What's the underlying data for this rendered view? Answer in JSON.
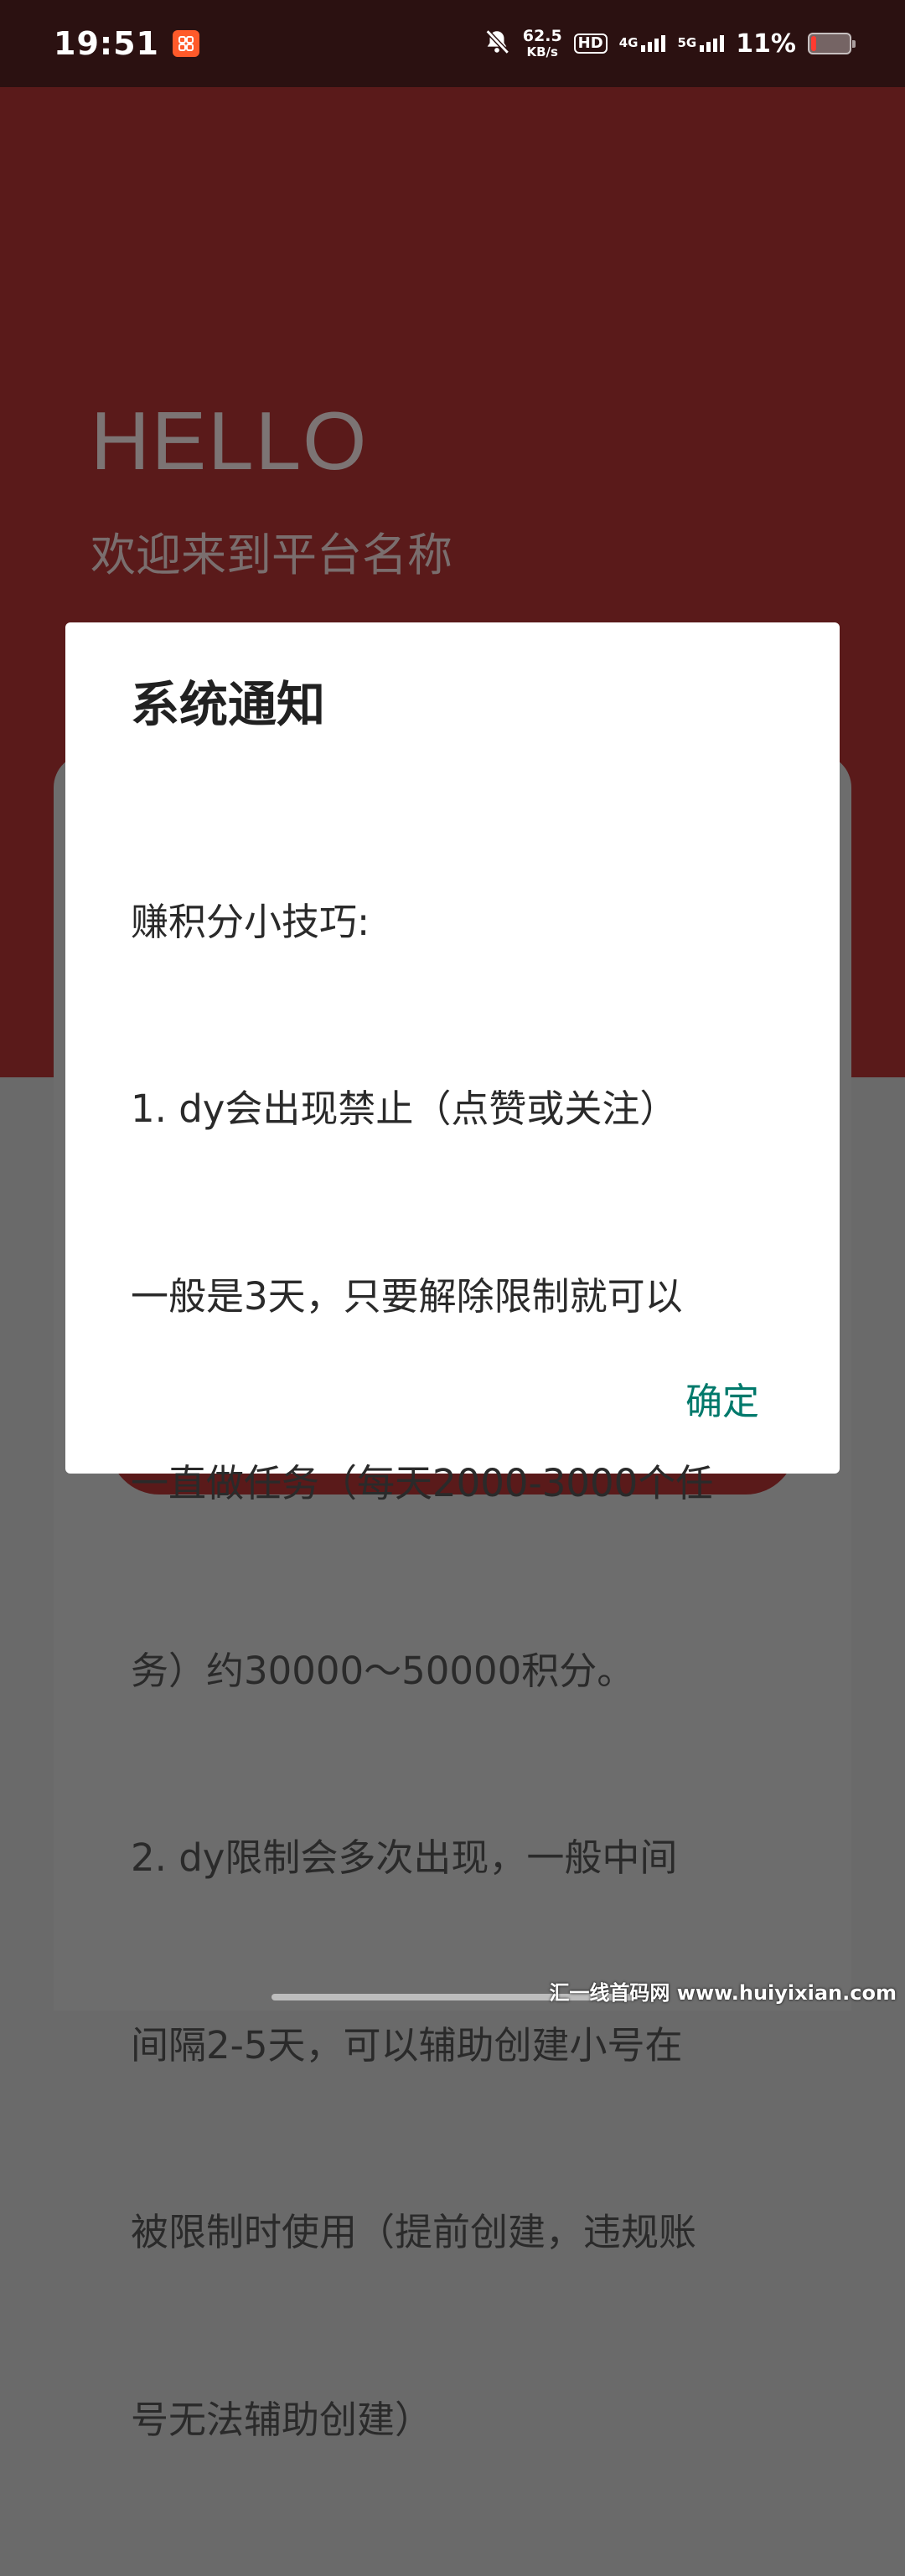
{
  "status_bar": {
    "time": "19:51",
    "app_icon": "app-notification-icon",
    "bell_icon": "bell-muted-icon",
    "speed_value": "62.5",
    "speed_unit": "KB/s",
    "hd_label": "HD",
    "sim1_label": "4G",
    "sim2_label": "5G",
    "battery_percent": "11%",
    "battery_level": 0.11
  },
  "background": {
    "hello": "HELLO",
    "welcome": "欢迎来到平台名称"
  },
  "dialog": {
    "title": "系统通知",
    "body_lines": [
      "赚积分小技巧:",
      "1. dy会出现禁止（点赞或关注）",
      "一般是3天，只要解除限制就可以",
      "一直做任务（每天2000-3000个任",
      "务）约30000～50000积分。",
      "2. dy限制会多次出现，一般中间",
      "间隔2-5天，可以辅助创建小号在",
      "被限制时使用（提前创建，违规账",
      "号无法辅助创建）"
    ],
    "ok_label": "确定"
  },
  "watermark": "汇一线首码网 www.huiyixian.com",
  "colors": {
    "accent": "#00796b",
    "header_red": "#5a1a1a",
    "status_bar": "#2b1111"
  }
}
